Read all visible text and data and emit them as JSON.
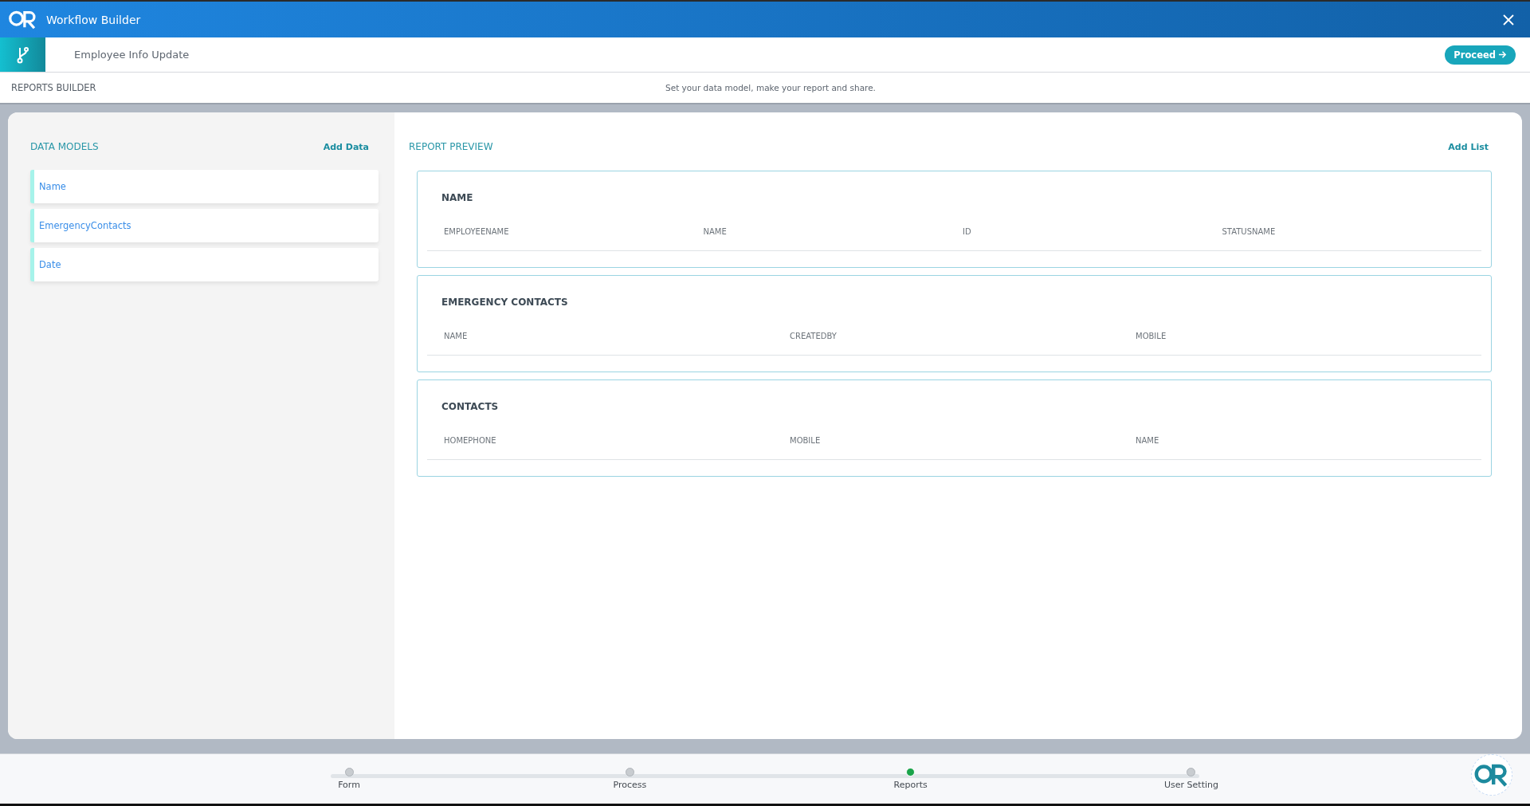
{
  "window": {
    "title": "Workflow Builder"
  },
  "workflow": {
    "name": "Employee Info Update",
    "proceed_button": "Proceed"
  },
  "builder": {
    "title": "REPORTS BUILDER",
    "subtitle": "Set your data model, make your report and share."
  },
  "data_models": {
    "title": "DATA MODELS",
    "add_button": "Add Data",
    "items": [
      {
        "label": "Name"
      },
      {
        "label": "EmergencyContacts"
      },
      {
        "label": "Date"
      }
    ]
  },
  "report_preview": {
    "title": "REPORT PREVIEW",
    "add_button": "Add List",
    "lists": [
      {
        "title": "NAME",
        "columns": [
          "EMPLOYEENAME",
          "NAME",
          "ID",
          "STATUSNAME"
        ]
      },
      {
        "title": "EMERGENCY CONTACTS",
        "columns": [
          "NAME",
          "CREATEDBY",
          "MOBILE"
        ]
      },
      {
        "title": "CONTACTS",
        "columns": [
          "HOMEPHONE",
          "MOBILE",
          "NAME"
        ]
      }
    ]
  },
  "steps": [
    {
      "label": "Form",
      "selected": false
    },
    {
      "label": "Process",
      "selected": false
    },
    {
      "label": "Reports",
      "selected": true
    },
    {
      "label": "User Setting",
      "selected": false
    }
  ]
}
